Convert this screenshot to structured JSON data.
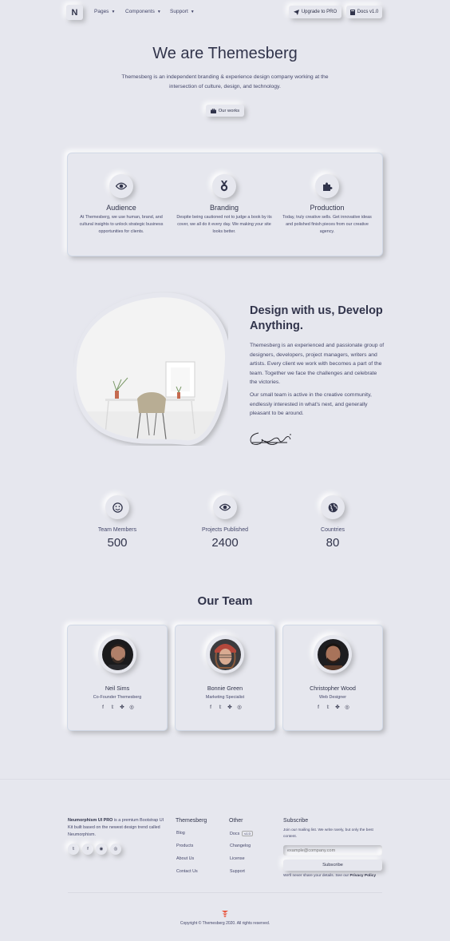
{
  "nav": {
    "logo": "N",
    "items": [
      "Pages",
      "Components",
      "Support"
    ],
    "upgrade_label": "Upgrade to PRO",
    "docs_label": "Docs v1.0"
  },
  "hero": {
    "title": "We are Themesberg",
    "subtitle": "Themesberg is an independent branding & experience design company working at the intersection of culture, design, and technology.",
    "button": "Our works"
  },
  "features": [
    {
      "icon": "eye-icon",
      "title": "Audience",
      "text": "At Themesberg, we use human, brand, and cultural insights to unlock strategic business opportunities for clients."
    },
    {
      "icon": "medal-icon",
      "title": "Branding",
      "text": "Despite being cautioned not to judge a book by its cover, we all do it every day. We making your site looks better."
    },
    {
      "icon": "puzzle-icon",
      "title": "Production",
      "text": "Today, truly creative sells. Get innovative ideas and polished finish pieces from our creative agency."
    }
  ],
  "about": {
    "title": "Design with us, Develop Anything.",
    "p1": "Themesberg is an experienced and passionate group of designers, developers, project managers, writers and artists. Every client we work with becomes a part of the team. Together we face the challenges and celebrate the victories.",
    "p2": "Our small team is active in the creative community, endlessly interested in what's next, and generally pleasant to be around."
  },
  "stats": [
    {
      "icon": "smile-icon",
      "label": "Team Members",
      "value": "500"
    },
    {
      "icon": "eye-icon",
      "label": "Projects Published",
      "value": "2400"
    },
    {
      "icon": "globe-icon",
      "label": "Countries",
      "value": "80"
    }
  ],
  "team": {
    "title": "Our Team",
    "members": [
      {
        "name": "Neil Sims",
        "role": "Co-Founder Themesberg"
      },
      {
        "name": "Bonnie Green",
        "role": "Marketing Specialist"
      },
      {
        "name": "Christopher Wood",
        "role": "Web Designer"
      }
    ],
    "social_glyphs": [
      "f",
      "𝕥",
      "✤",
      "◎"
    ]
  },
  "footer": {
    "brand": "Neumorphism UI PRO",
    "about": " is a premium Bootstrap UI Kit built based on the newest design trend called Neumorphism.",
    "social_glyphs": [
      "𝕥",
      "f",
      "◉",
      "◎"
    ],
    "col1_title": "Themesberg",
    "col1_links": [
      "Blog",
      "Products",
      "About Us",
      "Contact Us"
    ],
    "col2_title": "Other",
    "col2_links": [
      "Docs",
      "Changelog",
      "License",
      "Support"
    ],
    "docs_badge": "v1.0",
    "subscribe_title": "Subscribe",
    "subscribe_text": "Join our mailing list. We write rarely, but only the best content.",
    "email_placeholder": "example@company.com",
    "subscribe_button": "Subscribe",
    "note_prefix": "We'll never share your details. See our ",
    "note_link": "Privacy Policy",
    "copyright": "Copyright © Themesberg 2020. All rights reserved."
  }
}
